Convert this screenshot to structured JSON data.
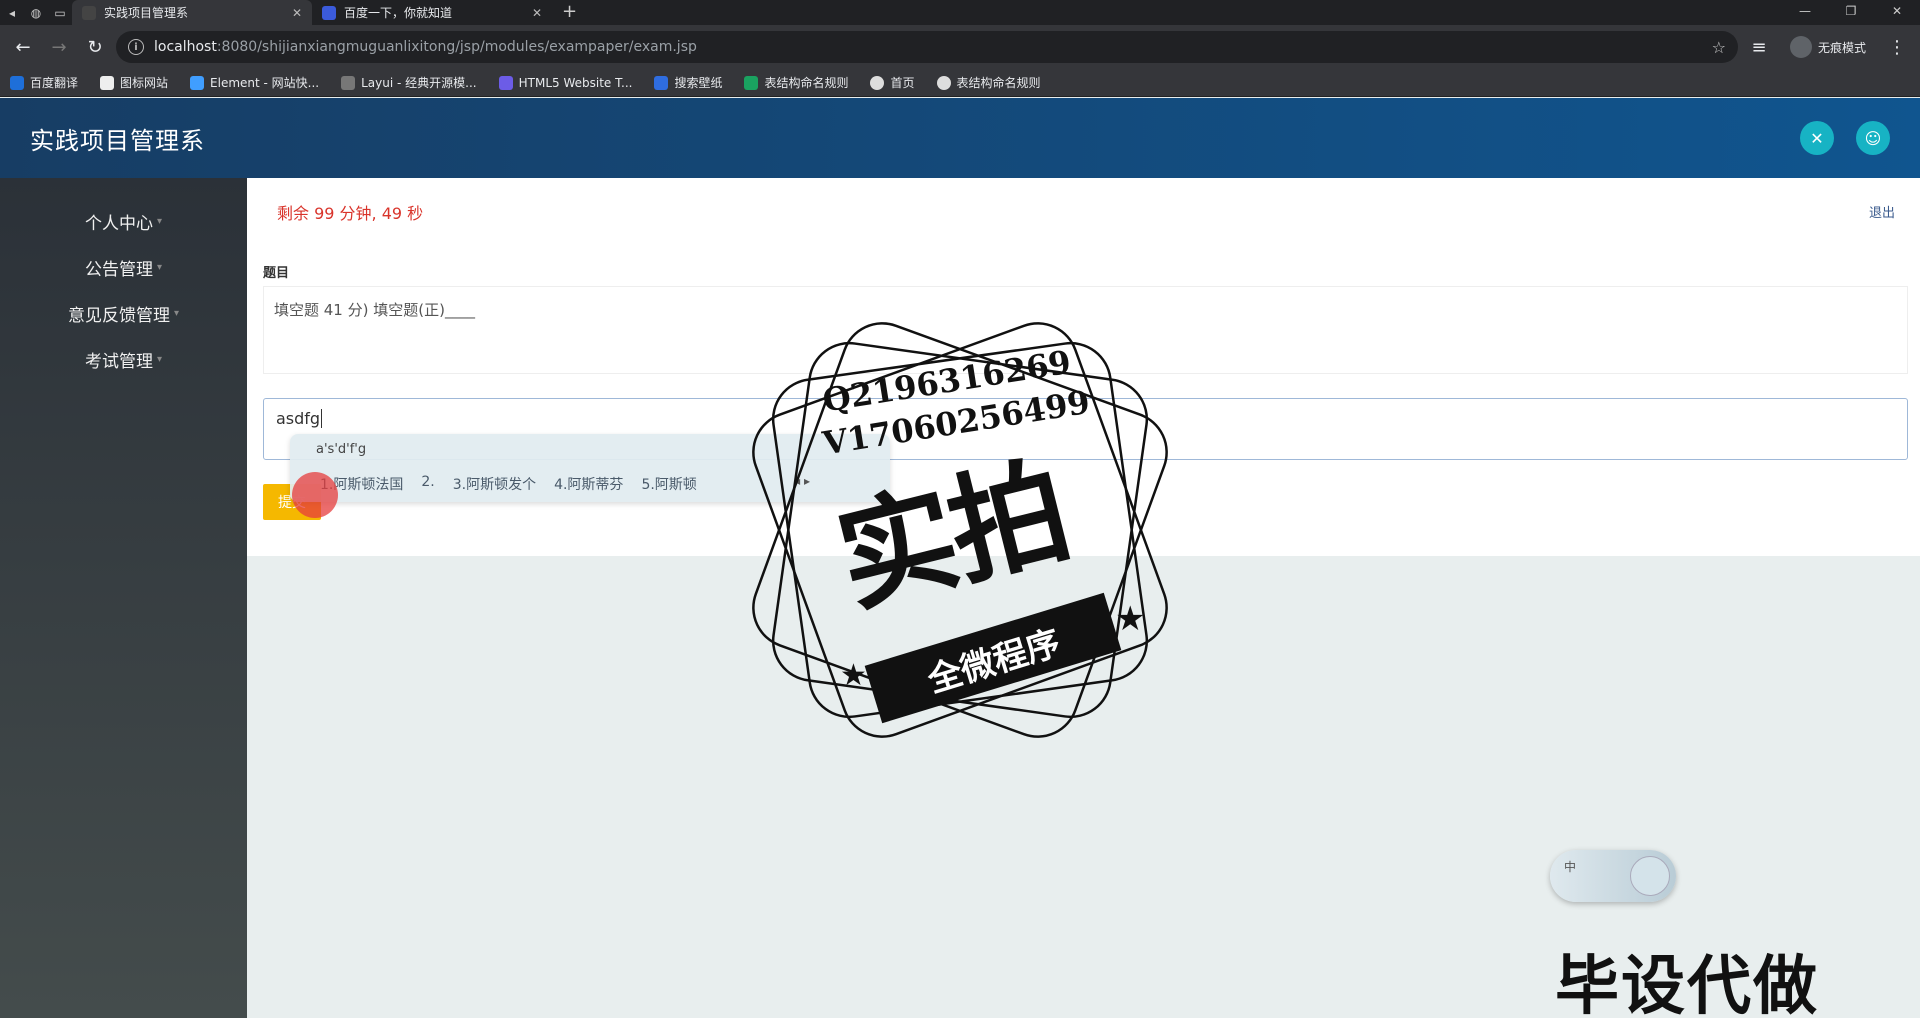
{
  "browser": {
    "tabs": [
      {
        "title": "实践项目管理系",
        "active": true
      },
      {
        "title": "百度一下，你就知道",
        "active": false
      }
    ],
    "url_host": "localhost",
    "url_path": ":8080/shijianxiangmuguanlixitong/jsp/modules/exampaper/exam.jsp",
    "incognito_label": "无痕模式",
    "bookmarks": [
      "百度翻译",
      "图标网站",
      "Element - 网站快...",
      "Layui - 经典开源模...",
      "HTML5 Website T...",
      "搜索壁纸",
      "表结构命名规则",
      "首页",
      "表结构命名规则"
    ]
  },
  "app": {
    "title": "实践项目管理系"
  },
  "sidebar": {
    "items": [
      {
        "label": "个人中心"
      },
      {
        "label": "公告管理"
      },
      {
        "label": "意见反馈管理"
      },
      {
        "label": "考试管理"
      }
    ]
  },
  "exam": {
    "timer": "剩余 99 分钟, 49 秒",
    "logout": "退出",
    "question_label": "题目",
    "question_text": "填空题 41 分) 填空题(正)____",
    "answer_value": "asdfg",
    "submit_label": "提交"
  },
  "ime": {
    "pinyin": "a's'd'f'g",
    "candidates": [
      "1.阿斯顿法国",
      "2.",
      "3.阿斯顿发个",
      "4.阿斯蒂芬",
      "5.阿斯顿"
    ],
    "toggle_label": "中"
  },
  "watermark": {
    "line1": "Q2196316269",
    "line2": "V17060256499",
    "big": "实拍",
    "banner": "全微程序",
    "bottom": "毕设代做"
  },
  "colors": {
    "header_start": "#173d64",
    "header_end": "#10558f",
    "timer": "#d9342b",
    "submit": "#f5b800",
    "icon_accent": "#17b3c4"
  }
}
